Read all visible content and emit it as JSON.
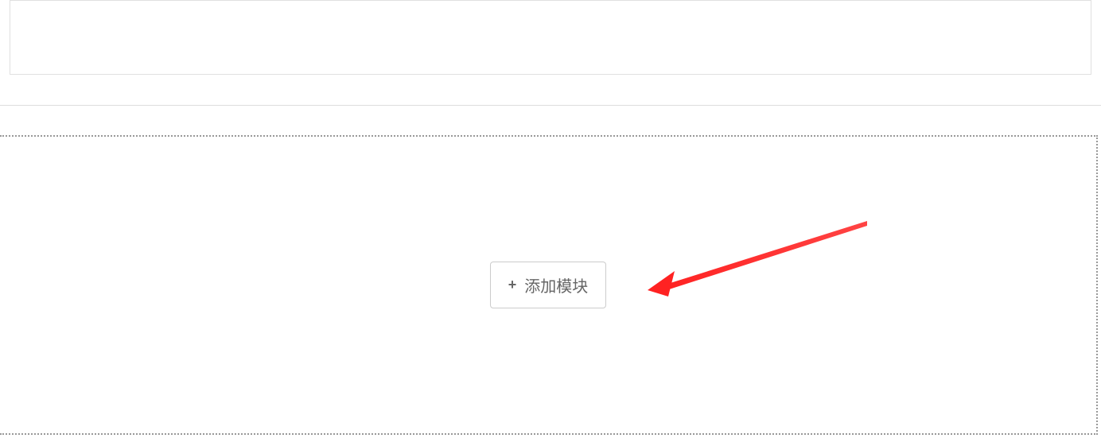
{
  "button": {
    "add_module_label": "添加模块",
    "plus_symbol": "+"
  },
  "annotation": {
    "arrow_color": "#ff3333"
  }
}
